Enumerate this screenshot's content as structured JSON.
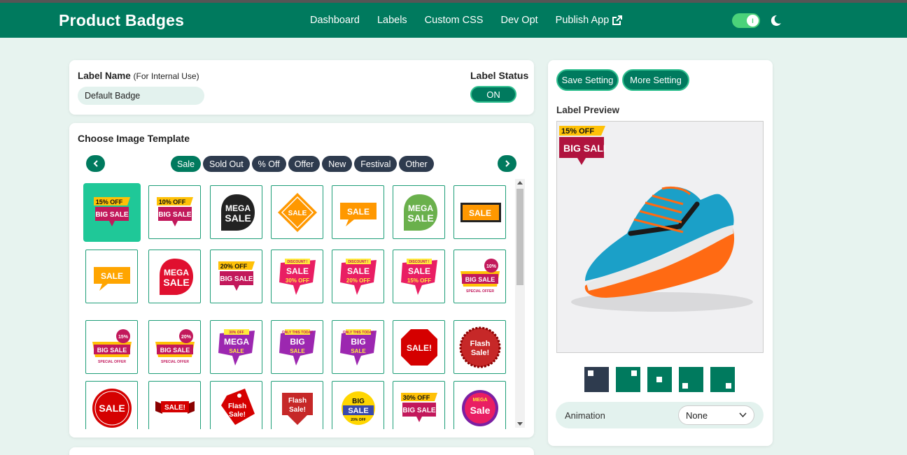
{
  "app": {
    "title": "Product Badges",
    "nav": [
      "Dashboard",
      "Labels",
      "Custom CSS",
      "Dev Opt",
      "Publish App"
    ],
    "theme_toggle": {
      "state": "on",
      "knob_text": "I"
    },
    "brand_color": "#007a5e"
  },
  "label_form": {
    "name_label": "Label Name",
    "name_hint": "(For Internal Use)",
    "name_value": "Default Badge",
    "status_label": "Label Status",
    "status_value": "ON"
  },
  "templates": {
    "title": "Choose Image Template",
    "categories": [
      "Sale",
      "Sold Out",
      "% Off",
      "Offer",
      "New",
      "Festival",
      "Other"
    ],
    "active_category": "Sale",
    "selected_index": 0,
    "badges": [
      {
        "kind": "ribbon",
        "top": "15% OFF",
        "main": "BIG SALE",
        "bg": "#c2185b"
      },
      {
        "kind": "ribbon",
        "top": "10% OFF",
        "main": "BIG SALE",
        "bg": "#c2185b"
      },
      {
        "kind": "blob",
        "main": "MEGA",
        "sub": "SALE",
        "bg": "#222"
      },
      {
        "kind": "diamond",
        "main": "SALE",
        "bg": "#ff9800"
      },
      {
        "kind": "speech",
        "main": "SALE",
        "bg": "#ff9800"
      },
      {
        "kind": "blob",
        "main": "MEGA",
        "sub": "SALE",
        "bg": "#6ab04c"
      },
      {
        "kind": "rect",
        "main": "SALE",
        "bg": "#ff9800"
      },
      {
        "kind": "speech",
        "main": "SALE",
        "bg": "#ffa500"
      },
      {
        "kind": "blob",
        "main": "MEGA",
        "sub": "SALE",
        "bg": "#e0102f"
      },
      {
        "kind": "ribbon",
        "top": "20% OFF",
        "main": "BIG SALE",
        "bg": "#c2185b"
      },
      {
        "kind": "burst",
        "top": "DISCOUNT !",
        "main": "SALE",
        "sub": "30% OFF",
        "bg": "#e91e63"
      },
      {
        "kind": "burst",
        "top": "DISCOUNT !",
        "main": "SALE",
        "sub": "20% OFF",
        "bg": "#e91e63"
      },
      {
        "kind": "burst",
        "top": "DISCOUNT !",
        "main": "SALE",
        "sub": "15% OFF",
        "bg": "#e91e63"
      },
      {
        "kind": "medal",
        "top": "10%",
        "main": "BIG SALE",
        "sub": "SPECIAL OFFER",
        "bg": "#c2185b"
      },
      {
        "kind": "medal",
        "top": "15%",
        "main": "BIG SALE",
        "sub": "SPECIAL OFFER",
        "bg": "#c2185b"
      },
      {
        "kind": "medal",
        "top": "20%",
        "main": "BIG SALE",
        "sub": "SPECIAL OFFER",
        "bg": "#c2185b"
      },
      {
        "kind": "burst",
        "top": "30% OFF",
        "main": "MEGA",
        "sub": "SALE",
        "bg": "#9c27b0"
      },
      {
        "kind": "burst",
        "top": "ONLY THIS TODAY",
        "main": "BIG",
        "sub": "SALE",
        "bg": "#9c27b0"
      },
      {
        "kind": "burst",
        "top": "ONLY THIS TODAY",
        "main": "BIG",
        "sub": "SALE",
        "bg": "#9c27b0"
      },
      {
        "kind": "octagon",
        "main": "SALE!",
        "bg": "#d50000"
      },
      {
        "kind": "seal",
        "main": "Flash",
        "sub": "Sale!",
        "bg": "#c62828"
      },
      {
        "kind": "circle",
        "main": "SALE",
        "bg": "#d50000"
      },
      {
        "kind": "banner",
        "main": "SALE!",
        "bg": "#d50000"
      },
      {
        "kind": "tag",
        "main": "Flash",
        "sub": "Sale!",
        "bg": "#d50000"
      },
      {
        "kind": "scroll",
        "main": "Flash",
        "sub": "Sale!",
        "bg": "#c62828"
      },
      {
        "kind": "circle2",
        "top": "BIG",
        "main": "SALE",
        "sub": "20% OFF",
        "bg": "#ffd600"
      },
      {
        "kind": "ribbon",
        "top": "30% OFF",
        "main": "BIG SALE",
        "bg": "#c2185b"
      },
      {
        "kind": "fancy",
        "top": "MEGA",
        "main": "Sale",
        "bg": "#e91e63"
      }
    ]
  },
  "preview": {
    "buttons": [
      "Save Setting",
      "More Setting"
    ],
    "title": "Label Preview",
    "badge_top": "15% OFF",
    "badge_main": "BIG SALE",
    "positions": [
      "top-left",
      "top-right",
      "center",
      "bottom-left",
      "bottom-right"
    ],
    "active_position": 0,
    "animation_label": "Animation",
    "animation_value": "None"
  }
}
